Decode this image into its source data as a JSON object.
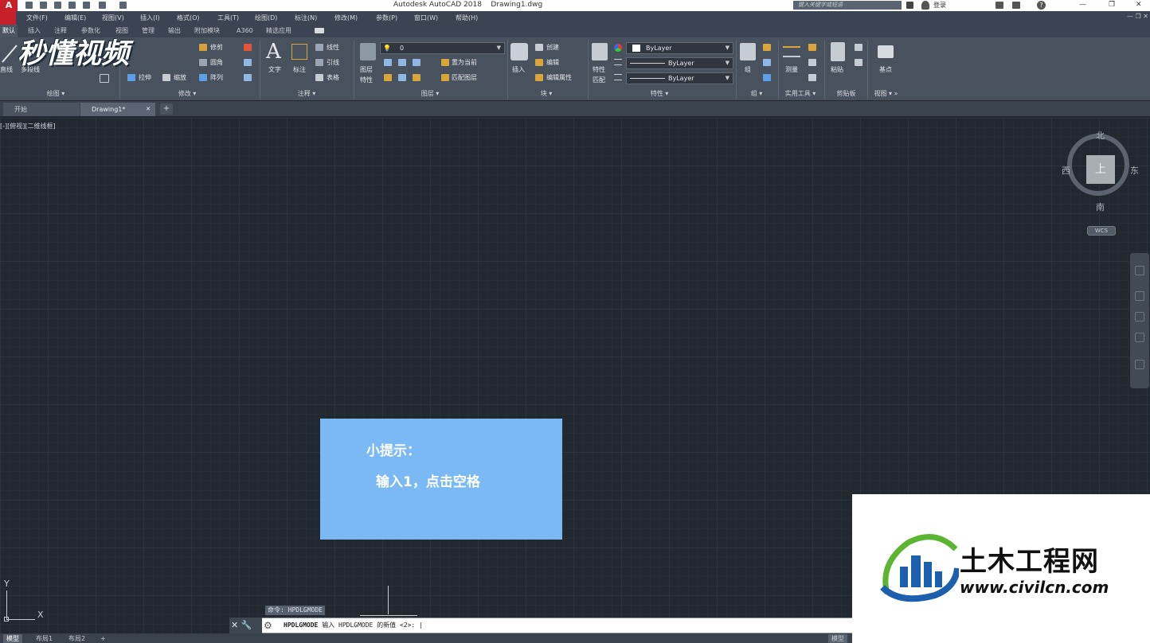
{
  "title_bar": {
    "app_title": "Autodesk AutoCAD 2018",
    "file_name": "Drawing1.dwg",
    "search_placeholder": "键入关键字或短语",
    "login": "登录",
    "minimize": "—",
    "restore": "❐",
    "close": "✕"
  },
  "menu": [
    "文件(F)",
    "编辑(E)",
    "视图(V)",
    "插入(I)",
    "格式(O)",
    "工具(T)",
    "绘图(D)",
    "标注(N)",
    "修改(M)",
    "参数(P)",
    "窗口(W)",
    "帮助(H)"
  ],
  "ribbon_tabs": [
    "默认",
    "插入",
    "注释",
    "参数化",
    "视图",
    "管理",
    "输出",
    "附加模块",
    "A360",
    "精选应用"
  ],
  "ribbon": {
    "draw": {
      "line": "直线",
      "polyline": "多段线",
      "label": "绘图"
    },
    "modify": {
      "trim": "修剪",
      "fillet": "圆角",
      "array": "阵列",
      "stretch": "拉伸",
      "scale": "缩放",
      "label": "修改"
    },
    "annotation": {
      "text": "文字",
      "dimension": "标注",
      "linear": "线性",
      "leader": "引线",
      "table": "表格",
      "label": "注释"
    },
    "layers": {
      "props": "图层",
      "props2": "特性",
      "current_layer": "0",
      "set_current": "置为当前",
      "match_layer": "匹配图层",
      "label": "图层"
    },
    "block": {
      "insert": "插入",
      "create": "创建",
      "edit": "编辑",
      "edit_attr": "编辑属性",
      "label": "块"
    },
    "properties": {
      "match": "特性",
      "match2": "匹配",
      "color": "ByLayer",
      "linetype": "ByLayer",
      "lineweight": "ByLayer",
      "label": "特性"
    },
    "groups": {
      "group": "组",
      "label": "组"
    },
    "utilities": {
      "measure": "测量",
      "label": "实用工具"
    },
    "clipboard": {
      "paste": "粘贴",
      "label": "剪贴板"
    },
    "view": {
      "base": "基点",
      "label": "视图"
    }
  },
  "file_tabs": {
    "start": "开始",
    "drawing": "Drawing1*",
    "add": "+"
  },
  "viewport_label": "[-][俯视][二维线框]",
  "viewcube": {
    "north": "北",
    "south": "南",
    "east": "东",
    "west": "西",
    "top": "上",
    "wcs": "WCS"
  },
  "tip": {
    "title": "小提示：",
    "body": "输入1，点击空格"
  },
  "ucs": {
    "x": "X",
    "y": "Y"
  },
  "command": {
    "history": "命令: HPDLGMODE",
    "prompt_cmd": "HPDLGMODE",
    "prompt_text": "输入 HPDLGMODE 的新值 <2>:"
  },
  "layout_tabs": [
    "模型",
    "布局1",
    "布局2",
    "+"
  ],
  "status": {
    "model": "模型"
  },
  "watermarks": {
    "left_logo": "秒懂视频",
    "brand": "土木工程网",
    "url": "www.civilcn.com"
  },
  "colors": {
    "canvas": "#212830",
    "ribbon": "#48525f",
    "tip_box": "#7ab9f3",
    "logo_blue": "#1c5fae",
    "logo_green": "#5cb531"
  }
}
